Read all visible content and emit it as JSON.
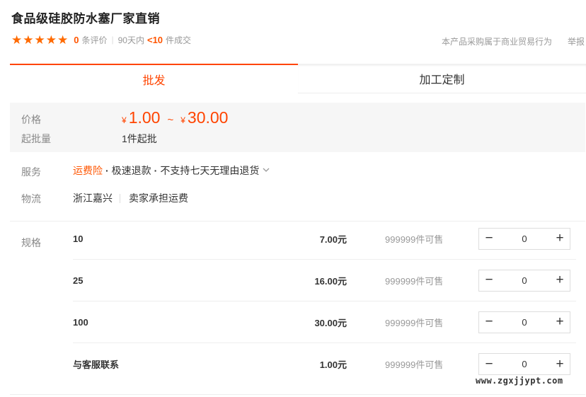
{
  "product": {
    "title": "食品级硅胶防水塞厂家直销"
  },
  "rating": {
    "stars": 5,
    "star_icon": "star-icon",
    "review_count": "0",
    "review_label": "条评价",
    "period": "90天内",
    "deal_count": "<10",
    "deal_label": "件成交"
  },
  "header_right": {
    "business_note": "本产品采购属于商业贸易行为",
    "report": "举报"
  },
  "tabs": [
    {
      "label": "批发",
      "active": true
    },
    {
      "label": "加工定制",
      "active": false
    }
  ],
  "price": {
    "label": "价格",
    "currency": "¥",
    "min": "1.00",
    "separator": "~",
    "max": "30.00",
    "moq_label": "起批量",
    "moq_value": "1件起批"
  },
  "service": {
    "label": "服务",
    "freight_insurance": "运费险",
    "fast_refund": "极速退款",
    "no_return": "不支持七天无理由退货",
    "chevron_icon": "chevron-down-icon"
  },
  "logistics": {
    "label": "物流",
    "origin": "浙江嘉兴",
    "shipping": "卖家承担运费"
  },
  "specs": {
    "label": "规格",
    "minus": "−",
    "plus": "+",
    "rows": [
      {
        "name": "10",
        "price": "7.00元",
        "stock": "999999件可售",
        "qty": "0"
      },
      {
        "name": "25",
        "price": "16.00元",
        "stock": "999999件可售",
        "qty": "0"
      },
      {
        "name": "100",
        "price": "30.00元",
        "stock": "999999件可售",
        "qty": "0"
      },
      {
        "name": "与客服联系",
        "price": "1.00元",
        "stock": "999999件可售",
        "qty": "0"
      }
    ]
  },
  "watermark": "www.zgxjjypt.com",
  "colors": {
    "accent": "#ff4400",
    "star": "#ff6a00",
    "panel_bg": "#f6f6f6"
  }
}
